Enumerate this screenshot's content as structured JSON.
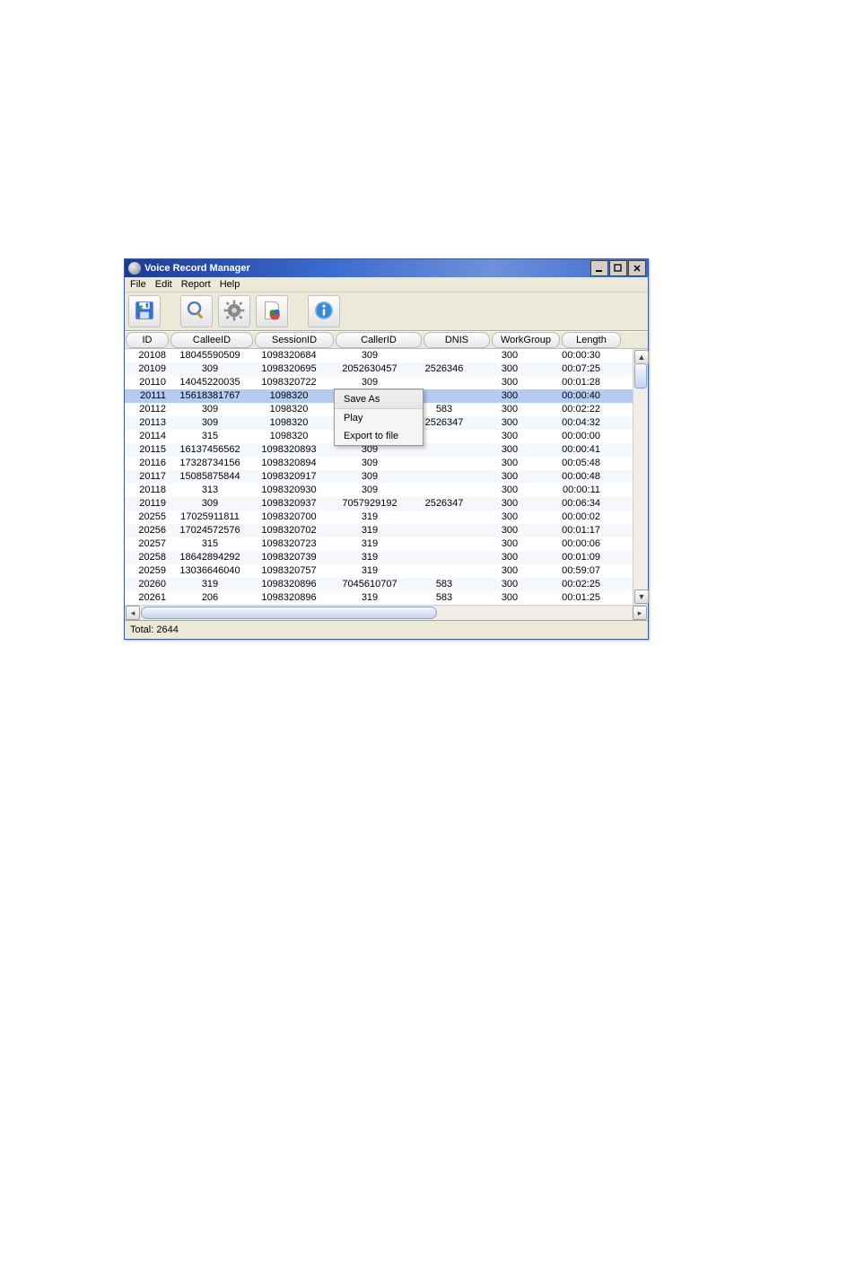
{
  "window": {
    "title": "Voice Record Manager"
  },
  "menu": {
    "file": "File",
    "edit": "Edit",
    "report": "Report",
    "help": "Help"
  },
  "columns": {
    "id": "ID",
    "calleeId": "CalleeID",
    "sessionId": "SessionID",
    "callerId": "CallerID",
    "dnis": "DNIS",
    "workGroup": "WorkGroup",
    "length": "Length"
  },
  "contextMenu": {
    "saveAs": "Save As",
    "play": "Play",
    "exportToFile": "Export to file"
  },
  "rows": [
    {
      "id": "20108",
      "calleeId": "18045590509",
      "sessionId": "1098320684",
      "callerId": "309",
      "dnis": "",
      "workGroup": "300",
      "length": "00:00:30"
    },
    {
      "id": "20109",
      "calleeId": "309",
      "sessionId": "1098320695",
      "callerId": "2052630457",
      "dnis": "2526346",
      "workGroup": "300",
      "length": "00:07:25"
    },
    {
      "id": "20110",
      "calleeId": "14045220035",
      "sessionId": "1098320722",
      "callerId": "309",
      "dnis": "",
      "workGroup": "300",
      "length": "00:01:28"
    },
    {
      "id": "20111",
      "calleeId": "15618381767",
      "sessionId": "1098320",
      "callerId": "",
      "dnis": "",
      "workGroup": "300",
      "length": "00:00:40",
      "selected": true
    },
    {
      "id": "20112",
      "calleeId": "309",
      "sessionId": "1098320",
      "callerId": "",
      "dnis": "583",
      "workGroup": "300",
      "length": "00:02:22"
    },
    {
      "id": "20113",
      "calleeId": "309",
      "sessionId": "1098320",
      "callerId": "",
      "dnis": "2526347",
      "workGroup": "300",
      "length": "00:04:32"
    },
    {
      "id": "20114",
      "calleeId": "315",
      "sessionId": "1098320",
      "callerId": "",
      "dnis": "",
      "workGroup": "300",
      "length": "00:00:00"
    },
    {
      "id": "20115",
      "calleeId": "16137456562",
      "sessionId": "1098320893",
      "callerId": "309",
      "dnis": "",
      "workGroup": "300",
      "length": "00:00:41"
    },
    {
      "id": "20116",
      "calleeId": "17328734156",
      "sessionId": "1098320894",
      "callerId": "309",
      "dnis": "",
      "workGroup": "300",
      "length": "00:05:48"
    },
    {
      "id": "20117",
      "calleeId": "15085875844",
      "sessionId": "1098320917",
      "callerId": "309",
      "dnis": "",
      "workGroup": "300",
      "length": "00:00:48"
    },
    {
      "id": "20118",
      "calleeId": "313",
      "sessionId": "1098320930",
      "callerId": "309",
      "dnis": "",
      "workGroup": "300",
      "length": "00:00:11"
    },
    {
      "id": "20119",
      "calleeId": "309",
      "sessionId": "1098320937",
      "callerId": "7057929192",
      "dnis": "2526347",
      "workGroup": "300",
      "length": "00:06:34"
    },
    {
      "id": "20255",
      "calleeId": "17025911811",
      "sessionId": "1098320700",
      "callerId": "319",
      "dnis": "",
      "workGroup": "300",
      "length": "00:00:02"
    },
    {
      "id": "20256",
      "calleeId": "17024572576",
      "sessionId": "1098320702",
      "callerId": "319",
      "dnis": "",
      "workGroup": "300",
      "length": "00:01:17"
    },
    {
      "id": "20257",
      "calleeId": "315",
      "sessionId": "1098320723",
      "callerId": "319",
      "dnis": "",
      "workGroup": "300",
      "length": "00:00:06"
    },
    {
      "id": "20258",
      "calleeId": "18642894292",
      "sessionId": "1098320739",
      "callerId": "319",
      "dnis": "",
      "workGroup": "300",
      "length": "00:01:09"
    },
    {
      "id": "20259",
      "calleeId": "13036646040",
      "sessionId": "1098320757",
      "callerId": "319",
      "dnis": "",
      "workGroup": "300",
      "length": "00:59:07"
    },
    {
      "id": "20260",
      "calleeId": "319",
      "sessionId": "1098320896",
      "callerId": "7045610707",
      "dnis": "583",
      "workGroup": "300",
      "length": "00:02:25"
    },
    {
      "id": "20261",
      "calleeId": "206",
      "sessionId": "1098320896",
      "callerId": "319",
      "dnis": "583",
      "workGroup": "300",
      "length": "00:01:25"
    }
  ],
  "status": {
    "total": "Total: 2644"
  }
}
